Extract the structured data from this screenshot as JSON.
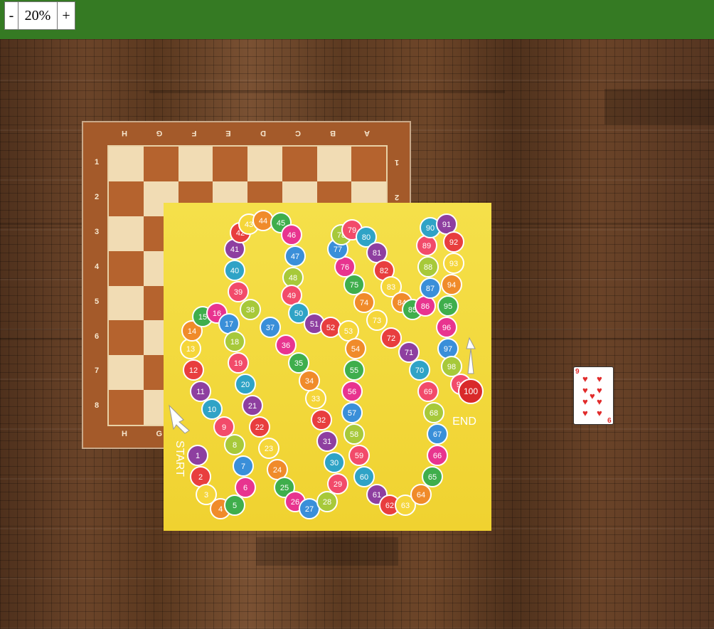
{
  "toolbar": {
    "zoom_out_label": "-",
    "zoom_level": "20%",
    "zoom_in_label": "+",
    "color": "#357a23"
  },
  "chessboard": {
    "files": [
      "H",
      "G",
      "F",
      "E",
      "D",
      "C",
      "B",
      "A"
    ],
    "ranks": [
      "1",
      "2",
      "3",
      "4",
      "5",
      "6",
      "7",
      "8"
    ],
    "bottom_files": [
      "H",
      "G"
    ]
  },
  "snakes_ladders": {
    "start_label": "START",
    "end_label": "END",
    "background": "#f3d93b"
  },
  "card": {
    "rank": "9",
    "suit": "hearts",
    "suit_symbol": "♥",
    "color": "#e12b2b"
  }
}
